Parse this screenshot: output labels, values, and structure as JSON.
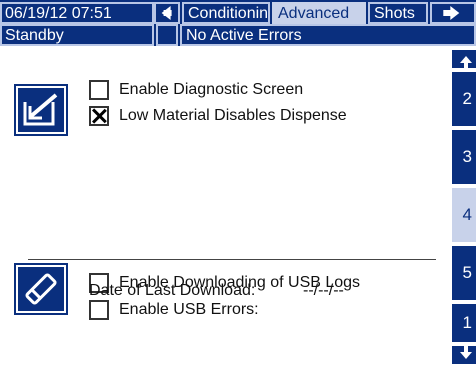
{
  "header": {
    "datetime": "06/19/12 07:51",
    "tabs": [
      {
        "label": "Conditioning",
        "active": false
      },
      {
        "label": "Advanced",
        "active": true
      },
      {
        "label": "Shots",
        "active": false
      }
    ]
  },
  "status": {
    "mode": "Standby",
    "errors": "No Active Errors"
  },
  "options_top": [
    {
      "label": "Enable Diagnostic Screen",
      "checked": false
    },
    {
      "label": "Low Material Disables Dispense",
      "checked": true
    }
  ],
  "options_usb": [
    {
      "label": "Enable Downloading of USB Logs",
      "checked": false
    },
    {
      "label": "Enable USB Errors:",
      "checked": false
    }
  ],
  "last_download": {
    "label": "Date of Last Download:",
    "value": "--/--/--"
  },
  "side_tabs": [
    "2",
    "3",
    "4",
    "5",
    "1"
  ],
  "side_active": "4",
  "icons": {
    "edit": "edit-icon",
    "eraser": "eraser-icon",
    "nav_left": "arrow-left-icon",
    "nav_right": "arrow-right-icon",
    "scroll_up": "arrow-up-icon",
    "scroll_down": "arrow-down-icon"
  },
  "colors": {
    "bar": "#0a2f7e",
    "active_tab": "#c8d2ea"
  }
}
